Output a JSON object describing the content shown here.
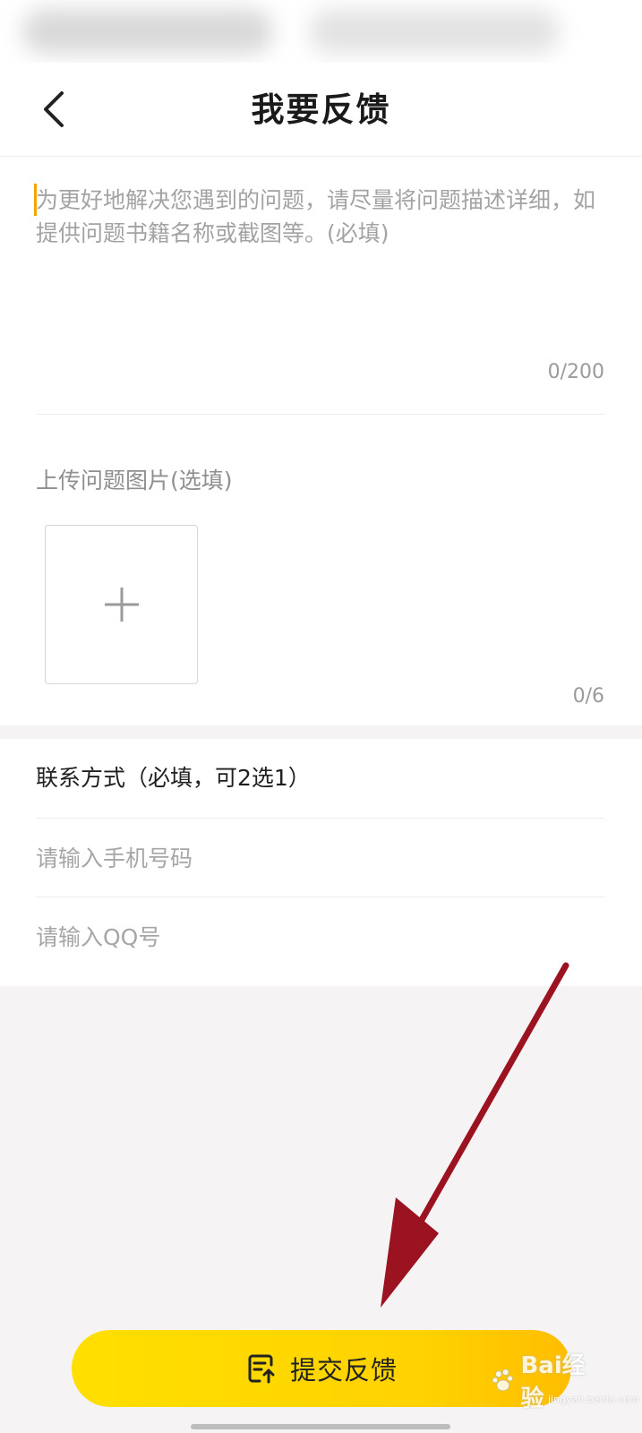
{
  "header": {
    "title": "我要反馈"
  },
  "description": {
    "placeholder": "为更好地解决您遇到的问题，请尽量将问题描述详细，如提供问题书籍名称或截图等。(必填)",
    "value": "",
    "counter": "0/200"
  },
  "upload": {
    "label": "上传问题图片(选填)",
    "counter": "0/6",
    "add_icon": "plus-icon"
  },
  "contact": {
    "title": "联系方式（必填，可2选1）",
    "phone_placeholder": "请输入手机号码",
    "qq_placeholder": "请输入QQ号"
  },
  "submit": {
    "label": "提交反馈",
    "icon": "submit-document-icon"
  },
  "watermark": {
    "text": "Bai经验",
    "sub": "jingyan.baidu.com"
  },
  "colors": {
    "accent_yellow": "#ffd500",
    "annotation_arrow": "#9b1320",
    "caret": "#f5a300",
    "page_background": "#f5f3f4"
  }
}
